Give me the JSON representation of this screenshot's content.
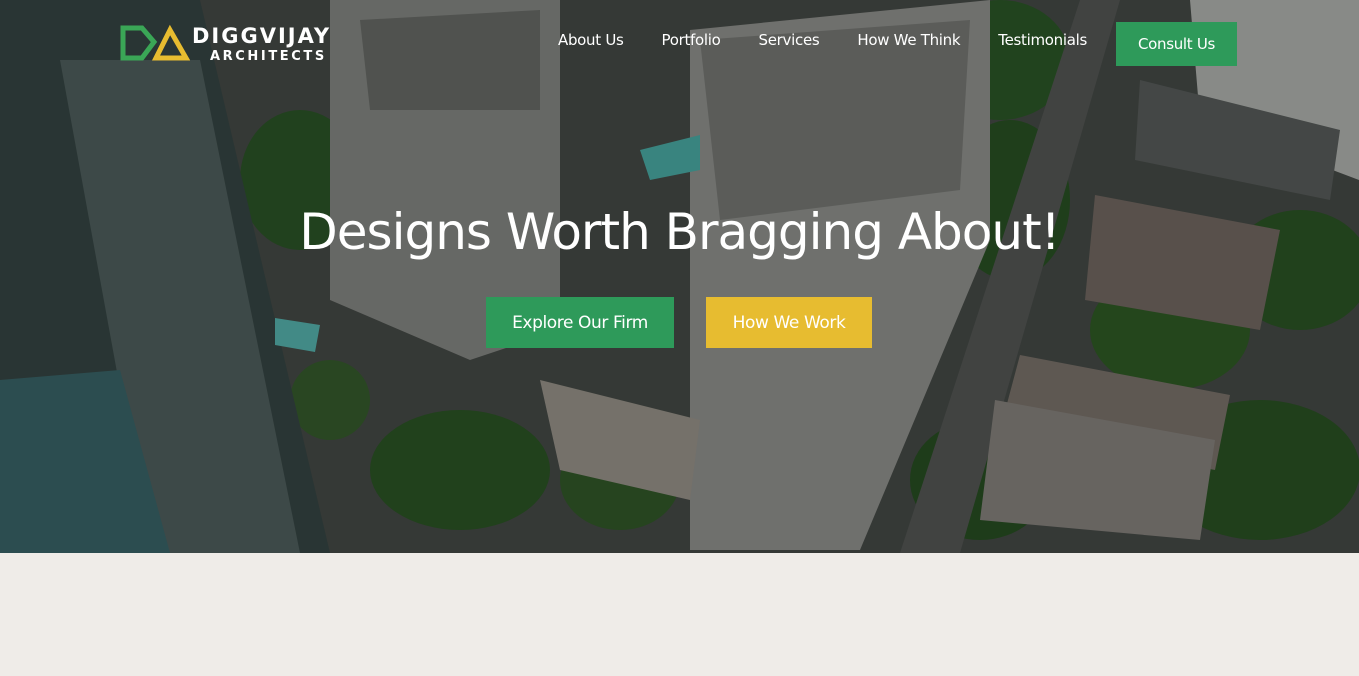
{
  "brand": {
    "name": "DIGGVIJAY",
    "sub": "ARCHITECTS",
    "colors": {
      "green": "#2e9a5a",
      "gold": "#e7bc30"
    }
  },
  "nav": {
    "items": [
      {
        "label": "About Us"
      },
      {
        "label": "Portfolio"
      },
      {
        "label": "Services"
      },
      {
        "label": "How We Think"
      },
      {
        "label": "Testimonials"
      }
    ],
    "cta_label": "Consult Us"
  },
  "hero": {
    "headline": "Designs Worth Bragging About!",
    "primary_cta": "Explore Our Firm",
    "secondary_cta": "How We Work",
    "background": "aerial-city-photo"
  }
}
